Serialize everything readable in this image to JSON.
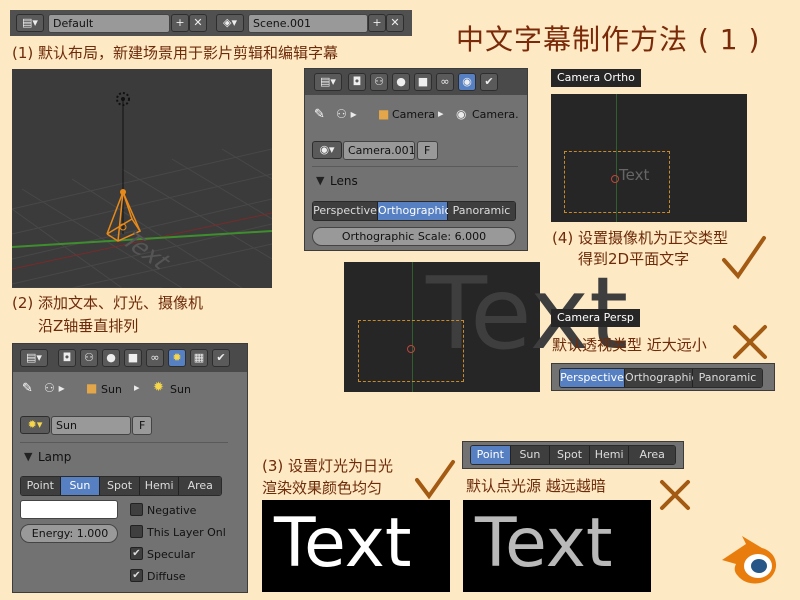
{
  "header": {
    "layout_name": "Default",
    "scene_name": "Scene.001",
    "title": "中文字幕制作方法 ( 1 )"
  },
  "notes": {
    "step1": "(1) 默认布局，新建场景用于影片剪辑和编辑字幕",
    "step2_line1": "(2) 添加文本、灯光、摄像机",
    "step2_line2": "沿Z轴垂直排列",
    "step3_line1": "(3) 设置灯光为日光",
    "step3_line2": "渲染效果颜色均匀",
    "step4_line1": "(4) 设置摄像机为正交类型",
    "step4_line2": "得到2D平面文字",
    "persp_note": "默认透视类型 近大远小",
    "point_note": "默认点光源 越远越暗"
  },
  "viewport": {
    "text_object": "Text"
  },
  "camera_panel": {
    "breadcrumb": [
      "Camera",
      "Camera."
    ],
    "datablock": "Camera.001",
    "fake_user": "F",
    "section": "Lens",
    "lens_types": [
      "Perspective",
      "Orthographic",
      "Panoramic"
    ],
    "active_lens": "Orthographic",
    "ortho_scale": "Orthographic Scale: 6.000"
  },
  "camera_ortho": {
    "label": "Camera Ortho",
    "text": "Text"
  },
  "camera_persp": {
    "label": "Camera Persp",
    "text": "Text",
    "lens_types": [
      "Perspective",
      "Orthographic",
      "Panoramic"
    ],
    "active_lens": "Perspective"
  },
  "lamp_panel": {
    "breadcrumb": [
      "Sun",
      "Sun"
    ],
    "datablock": "Sun",
    "fake_user": "F",
    "section": "Lamp",
    "lamp_types": [
      "Point",
      "Sun",
      "Spot",
      "Hemi",
      "Area"
    ],
    "active_lamp": "Sun",
    "energy": "Energy: 1.000",
    "options": [
      {
        "label": "Negative",
        "checked": false
      },
      {
        "label": "This Layer Onl",
        "checked": false
      },
      {
        "label": "Specular",
        "checked": true
      },
      {
        "label": "Diffuse",
        "checked": true
      }
    ]
  },
  "point_lamp_bar": {
    "lamp_types": [
      "Point",
      "Sun",
      "Spot",
      "Hemi",
      "Area"
    ],
    "active_lamp": "Point"
  },
  "render_sun": {
    "text": "Text"
  },
  "render_point": {
    "text": "Text"
  },
  "colors": {
    "background": "#fde9c4",
    "note_text": "#6e2b0a",
    "active_button": "#5680c2",
    "check_mark": "#a35a12"
  }
}
